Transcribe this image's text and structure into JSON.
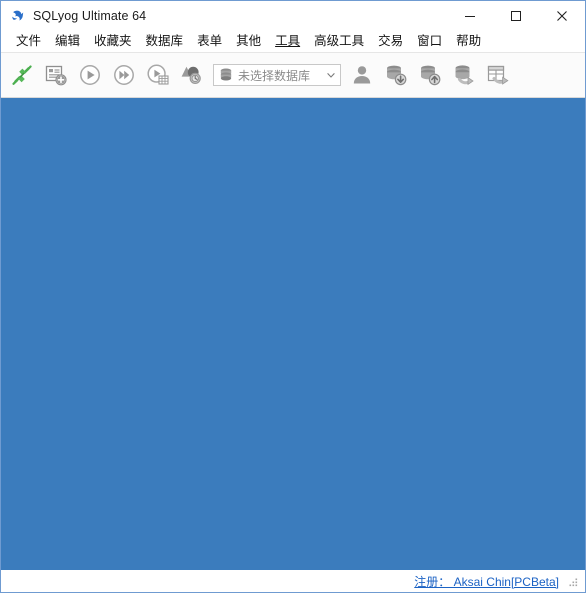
{
  "window": {
    "title": "SQLyog Ultimate 64",
    "app_icon": "dolphin-icon",
    "controls": {
      "minimize": "minimize-icon",
      "maximize": "maximize-icon",
      "close": "close-icon"
    },
    "border_color": "#6f9bd1"
  },
  "menubar": {
    "items": [
      {
        "label": "文件",
        "emphasized": false
      },
      {
        "label": "编辑",
        "emphasized": false
      },
      {
        "label": "收藏夹",
        "emphasized": false
      },
      {
        "label": "数据库",
        "emphasized": false
      },
      {
        "label": "表单",
        "emphasized": false
      },
      {
        "label": "其他",
        "emphasized": false
      },
      {
        "label": "工具",
        "emphasized": true
      },
      {
        "label": "高级工具",
        "emphasized": false
      },
      {
        "label": "交易",
        "emphasized": false
      },
      {
        "label": "窗口",
        "emphasized": false
      },
      {
        "label": "帮助",
        "emphasized": false
      }
    ]
  },
  "toolbar": {
    "buttons": [
      {
        "icon": "connect-plug-icon",
        "enabled": true,
        "color": "#4caf50"
      },
      {
        "icon": "new-query-document-icon",
        "enabled": false,
        "color": "#9a9a9a"
      },
      {
        "icon": "execute-play-icon",
        "enabled": false,
        "color": "#9a9a9a"
      },
      {
        "icon": "execute-all-forward-icon",
        "enabled": false,
        "color": "#9a9a9a"
      },
      {
        "icon": "execute-to-grid-icon",
        "enabled": false,
        "color": "#9a9a9a"
      },
      {
        "icon": "query-history-icon",
        "enabled": false,
        "color": "#9a9a9a"
      },
      {
        "icon": "user-manager-icon",
        "enabled": false,
        "color": "#9a9a9a"
      },
      {
        "icon": "database-import-icon",
        "enabled": false,
        "color": "#9a9a9a"
      },
      {
        "icon": "database-export-icon",
        "enabled": false,
        "color": "#9a9a9a"
      },
      {
        "icon": "database-backup-icon",
        "enabled": false,
        "color": "#9a9a9a"
      },
      {
        "icon": "table-export-icon",
        "enabled": false,
        "color": "#9a9a9a"
      }
    ],
    "database_combo": {
      "icon": "database-stack-icon",
      "value": "未选择数据库",
      "placeholder": "未选择数据库",
      "chevron": "chevron-down-icon",
      "options": [
        "未选择数据库"
      ]
    }
  },
  "client": {
    "background_color": "#3b7cbd"
  },
  "statusbar": {
    "registration_text": "注册： Aksai Chin[PCBeta]",
    "link_color": "#1b62c4",
    "grip": "resize-grip-icon"
  }
}
